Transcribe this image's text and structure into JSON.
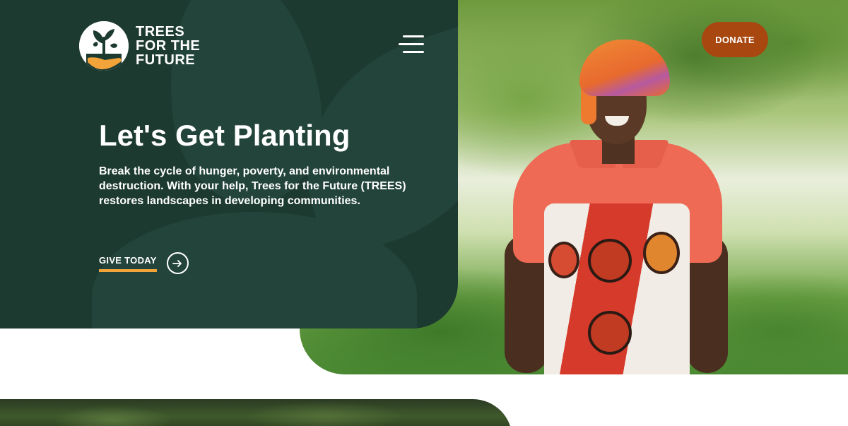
{
  "brand": {
    "name_lines": [
      "TREES",
      "FOR THE",
      "FUTURE"
    ],
    "logo_icon": "sprout-in-hand-icon",
    "colors": {
      "dark_green": "#1d3a31",
      "orange": "#f2a33a",
      "donate": "#a8470f"
    }
  },
  "header": {
    "menu_icon": "hamburger-menu-icon",
    "donate_label": "DONATE"
  },
  "hero": {
    "title": "Let's Get Planting",
    "description": "Break the cycle of hunger, poverty, and environmental destruction. With your help, Trees for the Future (TREES) restores landscapes in developing communities.",
    "cta_label": "GIVE TODAY",
    "cta_icon": "arrow-right-circle-icon",
    "photo": "smiling-woman-in-tree-nursery"
  },
  "next_section": {
    "photo": "forest-canopy"
  }
}
